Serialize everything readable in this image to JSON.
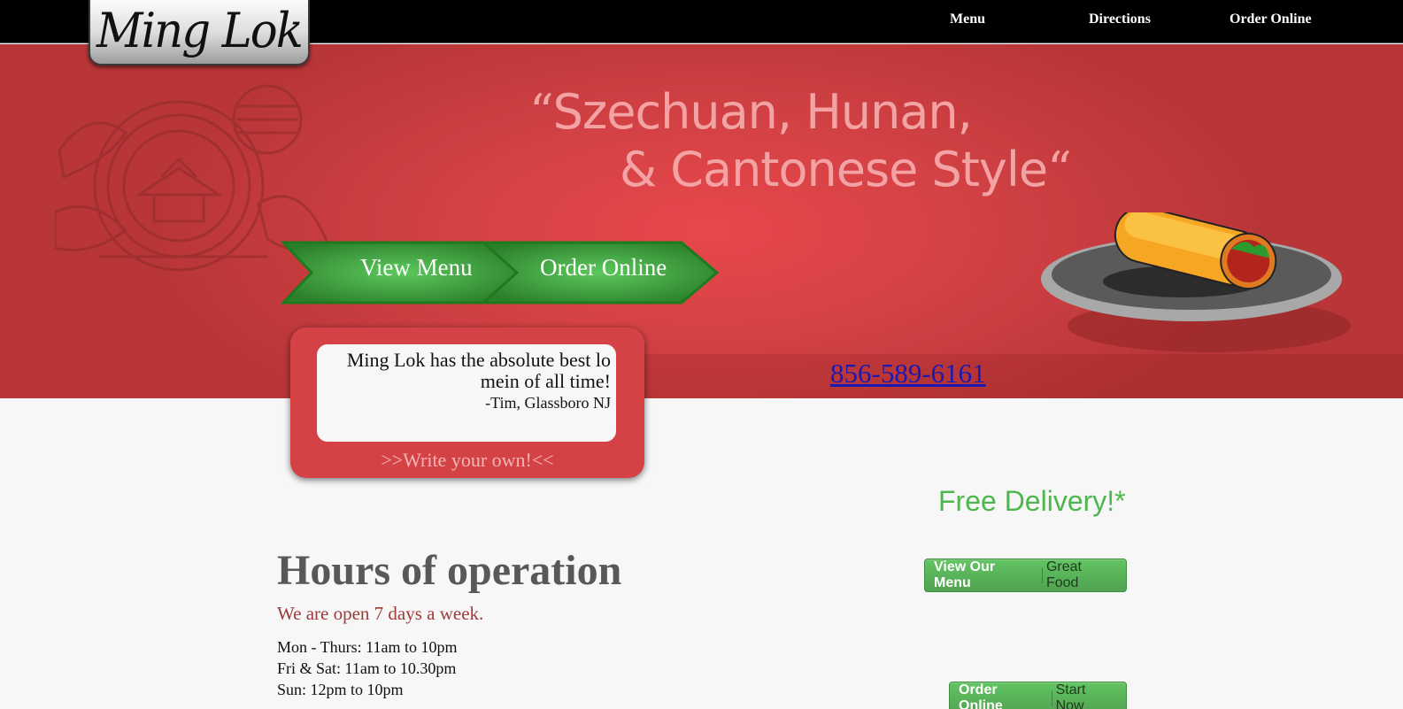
{
  "brand": {
    "logo_text": "Ming Lok"
  },
  "nav": {
    "items": [
      {
        "label": "Menu"
      },
      {
        "label": "Directions"
      },
      {
        "label": "Order Online"
      }
    ]
  },
  "hero": {
    "tagline_line1": "Szechuan, Hunan,",
    "tagline_line2": "& Cantonese Style",
    "open_quote": "“",
    "close_quote": "“",
    "arrow_buttons": [
      {
        "label": "View Menu"
      },
      {
        "label": "Order Online"
      }
    ],
    "phone": "856-589-6161"
  },
  "testimonial": {
    "quote": "Ming Lok has the absolute best lo mein of all time!",
    "author": "-Tim, Glassboro NJ",
    "write_own": ">>Write your own!<<"
  },
  "promo": {
    "free_delivery": "Free Delivery!*"
  },
  "hours": {
    "title": "Hours of operation",
    "subtitle": "We are open 7 days a week.",
    "lines": [
      "Mon - Thurs: 11am to 10pm",
      "Fri & Sat: 11am to 10.30pm",
      "Sun: 12pm to 10pm"
    ]
  },
  "cta_buttons": [
    {
      "label": "View Our Menu",
      "sub": "Great Food"
    },
    {
      "label": "Order Online",
      "sub": "Start Now"
    }
  ],
  "colors": {
    "hero_red": "#d44245",
    "green": "#5cb85c",
    "nav_black": "#000000",
    "tagline_pink": "#f3a3a3"
  }
}
